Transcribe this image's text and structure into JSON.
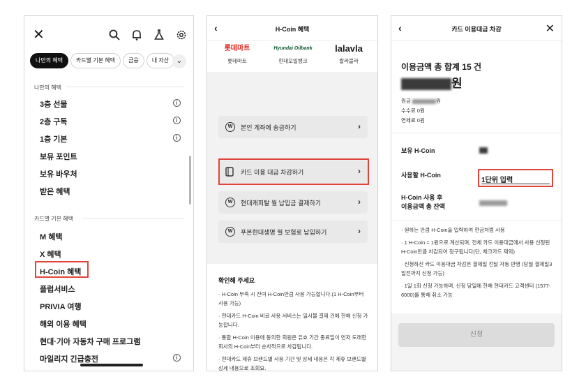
{
  "panel1": {
    "chips": [
      "나만의 혜택",
      "카드별 기본 혜택",
      "금융",
      "내 자산"
    ],
    "section_my_benefits": "나만의 혜택",
    "my_benefits": [
      {
        "label": "3층 선물",
        "info": true
      },
      {
        "label": "2층 구독",
        "info": true
      },
      {
        "label": "1층 기본",
        "info": true
      },
      {
        "label": "보유 포인트",
        "info": false
      },
      {
        "label": "보유 바우처",
        "info": false
      },
      {
        "label": "받은 혜택",
        "info": false
      }
    ],
    "section_card_benefits": "카드별 기본 혜택",
    "card_benefits": [
      {
        "label": "M 혜택",
        "info": false
      },
      {
        "label": "X 혜택",
        "info": false
      },
      {
        "label": "H-Coin 혜택",
        "info": false
      },
      {
        "label": "플럽서비스",
        "info": false
      },
      {
        "label": "PRIVIA 여행",
        "info": false
      },
      {
        "label": "해외 이용 혜택",
        "info": false
      },
      {
        "label": "현대·기아 자동차 구매 프로그램",
        "info": false
      },
      {
        "label": "마일리지 긴급충전",
        "info": true
      }
    ],
    "info_glyph": "i",
    "close_glyph": "✕",
    "chevron_glyph": "⌄"
  },
  "panel2": {
    "title": "H-Coin 혜택",
    "back_glyph": "‹",
    "partners": [
      {
        "mark": "롯데마트",
        "name": "롯데마트",
        "color": "#d9221a"
      },
      {
        "mark": "Hyundai Oilbank",
        "name": "현대오일뱅크",
        "color": "#0a5a2f"
      },
      {
        "mark": "lalavla",
        "name": "랄라블라",
        "color": "#222222"
      }
    ],
    "actions": [
      {
        "label": "본인 계좌에 송금하기",
        "icon": "W"
      },
      {
        "label": "카드 이용 대금 차감하기",
        "icon": "card"
      },
      {
        "label": "현대캐피탈 월 납입금 결제하기",
        "icon": "W"
      },
      {
        "label": "푸본현대생명 월 보험료 납입하기",
        "icon": "W"
      }
    ],
    "chevron_glyph": "›",
    "notice_title": "확인해 주세요",
    "notices": [
      "H-Coin 부족 시 잔여 H-Coin만큼 사용 가능합니다.(1 H-Coin부터 사용 가능)",
      "현대카드 H-Coin 비료 사용 서비스는 일시불 결제 건에 한해 신청 가능합니다.",
      "통합 H-Coin 이용에 동의한 회원은 유효 기간 종료일이 먼저 도래한 회사의 H-Coin부터 순차적으로 차감됩니다.",
      "현대카드 제휴 브랜드별 사용 기간 및 상세 내용은 각 제휴 브랜드별 상세 내용으로 조회요."
    ]
  },
  "panel3": {
    "title": "카드 이용대금 차감",
    "back_glyph": "‹",
    "close_glyph": "✕",
    "total_label": "이용금액 총 합계 15 건",
    "total_suffix": "원",
    "principal_label": "원금",
    "principal_suffix": "원",
    "fee_label": "수수료 0원",
    "late_label": "연체료 0원",
    "owned_label": "보유 H-Coin",
    "use_label": "사용할 H-Coin",
    "input_placeholder": "1단위 입력",
    "after_label_1": "H-Coin 사용 후",
    "after_label_2": "이용금액 총 잔액",
    "notes": [
      "원하는 만큼 H-Coin을 입력하여 현금처럼 사용",
      "1 H-Coin = 1원으로 계산되며, 전체 카드 이용대금에서 사용 신청된 H-Coin만큼 차감되어 청구됩니다(단, 체크카드 제외)",
      "신청하신 카드 이용대금 차감은 결제일 전달 자동 반영 (당월 결제일3일전까지 신청 가능)",
      "1일 1회 신청 가능하며, 신청 당일에 한해 현대카드 고객센터 (1577-6000)를 통해 취소 가능"
    ],
    "apply_label": "신청"
  },
  "colors": {
    "highlight": "#e0443c",
    "chip_active": "#111111",
    "action_bg": "#e9e9e9",
    "disabled_button": "#dcdcdc"
  }
}
